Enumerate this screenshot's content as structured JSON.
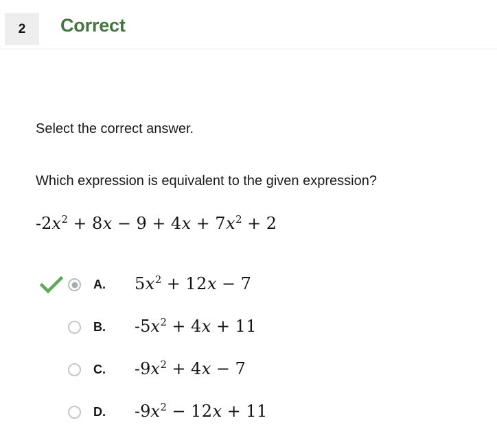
{
  "header": {
    "question_number": "2",
    "status_label": "Correct",
    "status_color": "#42763f",
    "badge_bg": "#eeeeee"
  },
  "body": {
    "instruction": "Select the correct answer.",
    "prompt": "Which expression is equivalent to the given expression?"
  },
  "given_expression": {
    "plain": "-2x^2 + 8x - 9 + 4x + 7x^2 + 2",
    "tokens": {
      "t1": "-2",
      "v1": "x",
      "e1": "2",
      "op1": "+",
      "t2": "8",
      "v2": "x",
      "op2": "−",
      "t3": "9",
      "op3": "+",
      "t4": "4",
      "v3": "x",
      "op4": "+",
      "t5": "7",
      "v4": "x",
      "e2": "2",
      "op5": "+",
      "t6": "2"
    }
  },
  "options": [
    {
      "letter": "A.",
      "plain": "5x^2 + 12x - 7",
      "selected": true,
      "correct": true,
      "check_icon": "check-icon",
      "tokens": {
        "c1": "5",
        "v1": "x",
        "e1": "2",
        "op1": "+",
        "c2": "12",
        "v2": "x",
        "op2": "−",
        "c3": "7"
      }
    },
    {
      "letter": "B.",
      "plain": "-5x^2 + 4x + 11",
      "selected": false,
      "correct": false,
      "check_icon": null,
      "tokens": {
        "c1": "-5",
        "v1": "x",
        "e1": "2",
        "op1": "+",
        "c2": "4",
        "v2": "x",
        "op2": "+",
        "c3": "11"
      }
    },
    {
      "letter": "C.",
      "plain": "-9x^2 + 4x - 7",
      "selected": false,
      "correct": false,
      "check_icon": null,
      "tokens": {
        "c1": "-9",
        "v1": "x",
        "e1": "2",
        "op1": "+",
        "c2": "4",
        "v2": "x",
        "op2": "−",
        "c3": "7"
      }
    },
    {
      "letter": "D.",
      "plain": "-9x^2 - 12x + 11",
      "selected": false,
      "correct": false,
      "check_icon": null,
      "tokens": {
        "c1": "-9",
        "v1": "x",
        "e1": "2",
        "op1": "−",
        "c2": "12",
        "v2": "x",
        "op2": "+",
        "c3": "11"
      }
    }
  ],
  "colors": {
    "check_green": "#5cab58",
    "radio_ring": "#c3c6c9",
    "radio_dot": "#a9aeb3",
    "divider": "#e4e6e8"
  }
}
